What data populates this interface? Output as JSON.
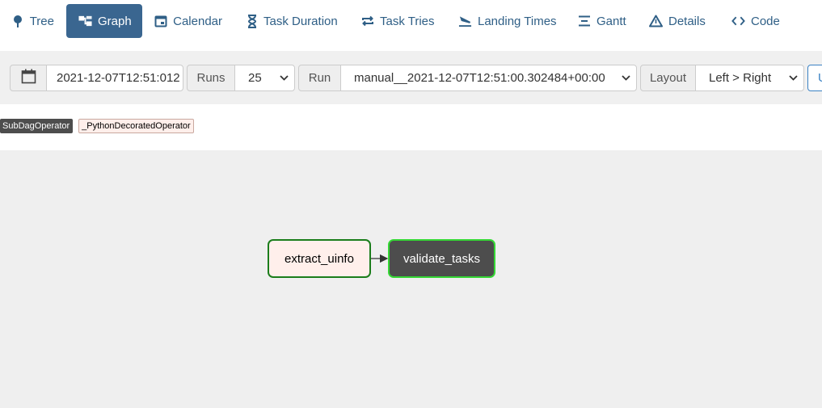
{
  "nav": {
    "tabs": [
      {
        "label": "Tree",
        "icon": "tree-icon",
        "active": false
      },
      {
        "label": "Graph",
        "icon": "graph-icon",
        "active": true
      },
      {
        "label": "Calendar",
        "icon": "calendar-icon",
        "active": false
      },
      {
        "label": "Task Duration",
        "icon": "hourglass-icon",
        "active": false
      },
      {
        "label": "Task Tries",
        "icon": "retry-icon",
        "active": false
      },
      {
        "label": "Landing Times",
        "icon": "plane-landing-icon",
        "active": false
      },
      {
        "label": "Gantt",
        "icon": "gantt-icon",
        "active": false
      },
      {
        "label": "Details",
        "icon": "warning-triangle-icon",
        "active": false
      },
      {
        "label": "Code",
        "icon": "code-icon",
        "active": false
      }
    ]
  },
  "controls": {
    "base_date": "2021-12-07T12:51:012",
    "runs_label": "Runs",
    "runs_value": "25",
    "run_label": "Run",
    "run_value": "manual__2021-12-07T12:51:00.302484+00:00",
    "layout_label": "Layout",
    "layout_value": "Left > Right",
    "update_label": "Update"
  },
  "legend": {
    "subdag": "SubDagOperator",
    "python": "_PythonDecoratedOperator"
  },
  "graph": {
    "nodes": [
      {
        "label": "extract_uinfo",
        "operator": "_PythonDecoratedOperator",
        "state_color": "#1b7d1b"
      },
      {
        "label": "validate_tasks",
        "operator": "SubDagOperator",
        "state_color": "#35d835"
      }
    ]
  },
  "colors": {
    "accent": "#3a6690",
    "link": "#2f5f86",
    "success": "#35d835",
    "dark_green": "#1b7d1b"
  }
}
